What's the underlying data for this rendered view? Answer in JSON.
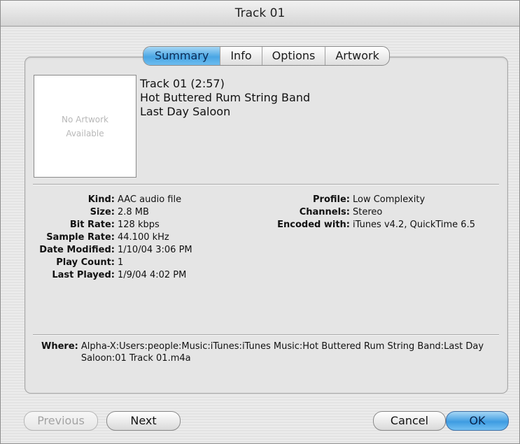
{
  "window": {
    "title": "Track 01"
  },
  "tabs": [
    {
      "label": "Summary",
      "active": true
    },
    {
      "label": "Info",
      "active": false
    },
    {
      "label": "Options",
      "active": false
    },
    {
      "label": "Artwork",
      "active": false
    }
  ],
  "artwork": {
    "line1": "No Artwork",
    "line2": "Available"
  },
  "track": {
    "name_duration": "Track 01 (2:57)",
    "artist": "Hot Buttered Rum String Band",
    "album": "Last Day Saloon"
  },
  "properties_left": [
    {
      "key": "Kind:",
      "value": "AAC audio file"
    },
    {
      "key": "Size:",
      "value": "2.8 MB"
    },
    {
      "key": "Bit Rate:",
      "value": "128 kbps"
    },
    {
      "key": "Sample Rate:",
      "value": "44.100 kHz"
    },
    {
      "key": "Date Modified:",
      "value": "1/10/04 3:06 PM"
    },
    {
      "key": "Play Count:",
      "value": "1"
    },
    {
      "key": "Last Played:",
      "value": "1/9/04 4:02 PM"
    }
  ],
  "properties_right": [
    {
      "key": "Profile:",
      "value": "Low Complexity"
    },
    {
      "key": "Channels:",
      "value": "Stereo"
    },
    {
      "key": "Encoded with:",
      "value": "iTunes v4.2, QuickTime 6.5"
    }
  ],
  "where": {
    "key": "Where:",
    "value": "Alpha-X:Users:people:Music:iTunes:iTunes Music:Hot Buttered Rum String Band:Last Day Saloon:01 Track 01.m4a"
  },
  "buttons": {
    "previous": "Previous",
    "next": "Next",
    "cancel": "Cancel",
    "ok": "OK"
  },
  "colors": {
    "accent_blue": "#4aa6e4",
    "window_bg": "#ececec"
  }
}
